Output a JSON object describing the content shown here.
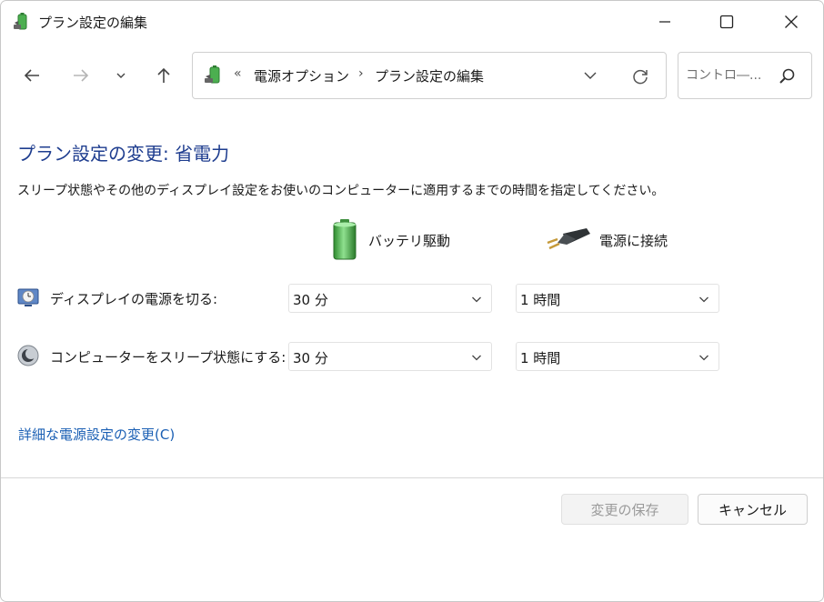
{
  "window": {
    "title": "プラン設定の編集",
    "title_icon": "power-options-icon",
    "controls": [
      "minimize-icon",
      "maximize-icon",
      "close-icon"
    ]
  },
  "nav": {
    "back_icon": "arrow-left-icon",
    "forward_icon": "arrow-right-icon",
    "recent_icon": "chevron-down-icon",
    "up_icon": "arrow-up-icon"
  },
  "address": {
    "overflow": "«",
    "crumbs": [
      "電源オプション",
      "プラン設定の編集"
    ],
    "separator": "›"
  },
  "search": {
    "placeholder": "コントロ―..."
  },
  "content": {
    "heading": "プラン設定の変更: 省電力",
    "description": "スリープ状態やその他のディスプレイ設定をお使いのコンピューターに適用するまでの時間を指定してください。",
    "columns": {
      "battery": "バッテリ駆動",
      "plugged": "電源に接続"
    },
    "rows": [
      {
        "label": "ディスプレイの電源を切る:",
        "battery": "30 分",
        "plugged": "1 時間",
        "icon": "display-off-icon"
      },
      {
        "label": "コンピューターをスリープ状態にする:",
        "battery": "30 分",
        "plugged": "1 時間",
        "icon": "sleep-moon-icon"
      }
    ],
    "advanced_link": "詳細な電源設定の変更(C)"
  },
  "footer": {
    "save_label": "変更の保存",
    "cancel_label": "キャンセル"
  },
  "colors": {
    "heading": "#1e3d8f",
    "link": "#1a5fb4",
    "battery_green": "#3aa63a"
  }
}
